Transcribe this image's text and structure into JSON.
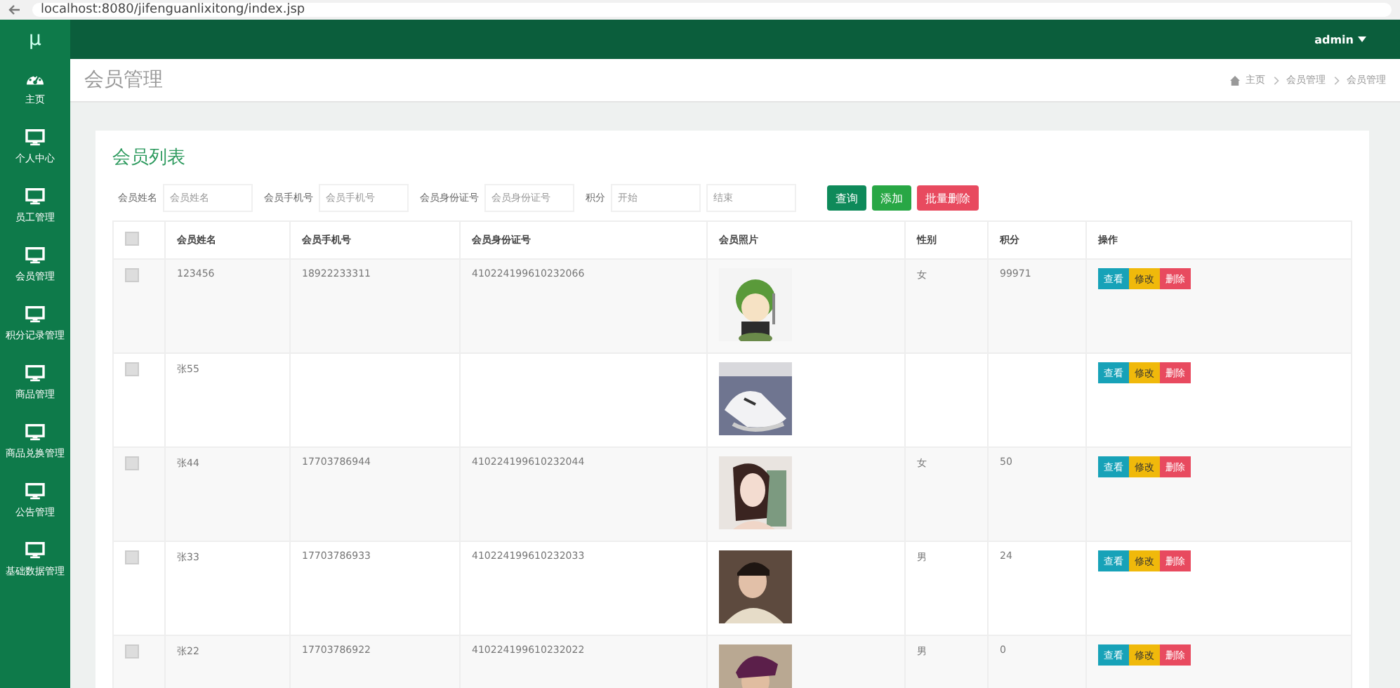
{
  "browser": {
    "url": "localhost:8080/jifenguanlixitong/index.jsp"
  },
  "topbar": {
    "logo": "μ",
    "user": "admin"
  },
  "sidebar": {
    "items": [
      {
        "label": "主页",
        "kind": "dashboard",
        "selected": false
      },
      {
        "label": "个人中心",
        "kind": "monitor",
        "selected": false
      },
      {
        "label": "员工管理",
        "kind": "monitor",
        "selected": false
      },
      {
        "label": "会员管理",
        "kind": "monitor",
        "selected": false
      },
      {
        "label": "积分记录管理",
        "kind": "monitor",
        "selected": false
      },
      {
        "label": "商品管理",
        "kind": "monitor",
        "selected": false
      },
      {
        "label": "商品兑换管理",
        "kind": "monitor",
        "selected": false
      },
      {
        "label": "公告管理",
        "kind": "monitor",
        "selected": false
      },
      {
        "label": "基础数据管理",
        "kind": "monitor",
        "selected": false
      }
    ]
  },
  "page": {
    "title": "会员管理",
    "breadcrumb": [
      "主页",
      "会员管理",
      "会员管理"
    ]
  },
  "card": {
    "title": "会员列表"
  },
  "filters": [
    {
      "label": "会员姓名",
      "placeholders": [
        "会员姓名"
      ]
    },
    {
      "label": "会员手机号",
      "placeholders": [
        "会员手机号"
      ]
    },
    {
      "label": "会员身份证号",
      "placeholders": [
        "会员身份证号"
      ]
    },
    {
      "label": "积分",
      "placeholders": [
        "开始",
        "结束"
      ]
    }
  ],
  "filter_buttons": [
    {
      "label": "查询",
      "kind": "search"
    },
    {
      "label": "添加",
      "kind": "add"
    },
    {
      "label": "批量删除",
      "kind": "delete"
    }
  ],
  "table": {
    "select_all_checked": false,
    "columns": [
      "会员姓名",
      "会员手机号",
      "会员身份证号",
      "会员照片",
      "性别",
      "积分",
      "操作"
    ],
    "rows": [
      {
        "checked": false,
        "name": "123456",
        "phone": "18922233311",
        "id_number": "410224199610232066",
        "photo": {
          "kind": "picture"
        },
        "gender": "女",
        "points": "99971",
        "actions": [
          {
            "label": "查看",
            "kind": "view"
          },
          {
            "label": "修改",
            "kind": "edit"
          },
          {
            "label": "删除",
            "kind": "delete"
          }
        ]
      },
      {
        "checked": false,
        "name": "张55",
        "photo": {
          "kind": "picture"
        },
        "actions": [
          {
            "label": "查看",
            "kind": "view"
          },
          {
            "label": "修改",
            "kind": "edit"
          },
          {
            "label": "删除",
            "kind": "delete"
          }
        ]
      },
      {
        "checked": false,
        "name": "张44",
        "phone": "17703786944",
        "id_number": "410224199610232044",
        "photo": {
          "kind": "picture"
        },
        "gender": "女",
        "points": "50",
        "actions": [
          {
            "label": "查看",
            "kind": "view"
          },
          {
            "label": "修改",
            "kind": "edit"
          },
          {
            "label": "删除",
            "kind": "delete"
          }
        ]
      },
      {
        "checked": false,
        "name": "张33",
        "phone": "17703786933",
        "id_number": "410224199610232033",
        "photo": {
          "kind": "picture"
        },
        "gender": "男",
        "points": "24",
        "actions": [
          {
            "label": "查看",
            "kind": "view"
          },
          {
            "label": "修改",
            "kind": "edit"
          },
          {
            "label": "删除",
            "kind": "delete"
          }
        ]
      },
      {
        "checked": false,
        "name": "张22",
        "phone": "17703786922",
        "id_number": "410224199610232022",
        "photo": {
          "kind": "picture"
        },
        "gender": "男",
        "points": "0",
        "actions": [
          {
            "label": "查看",
            "kind": "view"
          },
          {
            "label": "修改",
            "kind": "edit"
          },
          {
            "label": "删除",
            "kind": "delete"
          }
        ]
      }
    ]
  }
}
